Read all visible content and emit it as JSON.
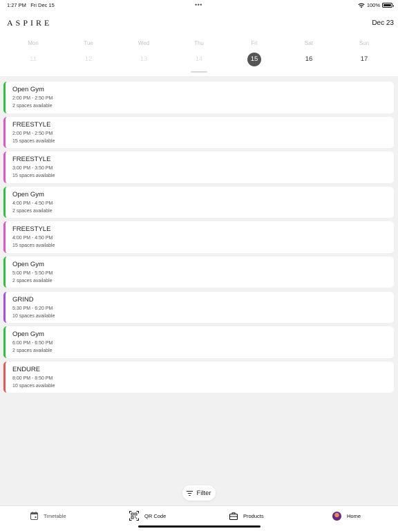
{
  "status_bar": {
    "time": "1:27 PM",
    "date": "Fri Dec 15",
    "dots": "•••",
    "battery": "100%",
    "battery_level": 1.0
  },
  "header": {
    "logo": "ASPIRE",
    "date": "Dec 23"
  },
  "week": [
    {
      "name": "Mon",
      "num": "11",
      "state": "past"
    },
    {
      "name": "Tue",
      "num": "12",
      "state": "past"
    },
    {
      "name": "Wed",
      "num": "13",
      "state": "past"
    },
    {
      "name": "Thu",
      "num": "14",
      "state": "past"
    },
    {
      "name": "Fri",
      "num": "15",
      "state": "active"
    },
    {
      "name": "Sat",
      "num": "16",
      "state": "future"
    },
    {
      "name": "Sun",
      "num": "17",
      "state": "future"
    }
  ],
  "classes": [
    {
      "title": "Open Gym",
      "time": "2:00 PM - 2:50 PM",
      "spaces": "2 spaces available",
      "color": "#2fc13c"
    },
    {
      "title": "FREESTYLE",
      "time": "2:00 PM - 2:50 PM",
      "spaces": "15 spaces available",
      "color": "#e056c8"
    },
    {
      "title": "FREESTYLE",
      "time": "3:00 PM - 3:50 PM",
      "spaces": "15 spaces available",
      "color": "#e056c8"
    },
    {
      "title": "Open Gym",
      "time": "4:00 PM - 4:50 PM",
      "spaces": "2 spaces available",
      "color": "#2fc13c"
    },
    {
      "title": "FREESTYLE",
      "time": "4:00 PM - 4:50 PM",
      "spaces": "15 spaces available",
      "color": "#e056c8"
    },
    {
      "title": "Open Gym",
      "time": "5:00 PM - 5:50 PM",
      "spaces": "2 spaces available",
      "color": "#2fc13c"
    },
    {
      "title": "GRIND",
      "time": "5:30 PM - 6:20 PM",
      "spaces": "10 spaces available",
      "color": "#a64de8"
    },
    {
      "title": "Open Gym",
      "time": "6:00 PM - 6:50 PM",
      "spaces": "2 spaces available",
      "color": "#2fc13c"
    },
    {
      "title": "ENDURE",
      "time": "8:00 PM - 8:50 PM",
      "spaces": "10 spaces available",
      "color": "#e85555"
    }
  ],
  "filter": {
    "label": "Filter",
    "icon": "filter-icon"
  },
  "tabs": [
    {
      "label": "Timetable",
      "icon": "calendar-icon"
    },
    {
      "label": "QR Code",
      "icon": "qr-code-icon"
    },
    {
      "label": "Products",
      "icon": "briefcase-icon"
    },
    {
      "label": "Home",
      "icon": "avatar"
    }
  ]
}
